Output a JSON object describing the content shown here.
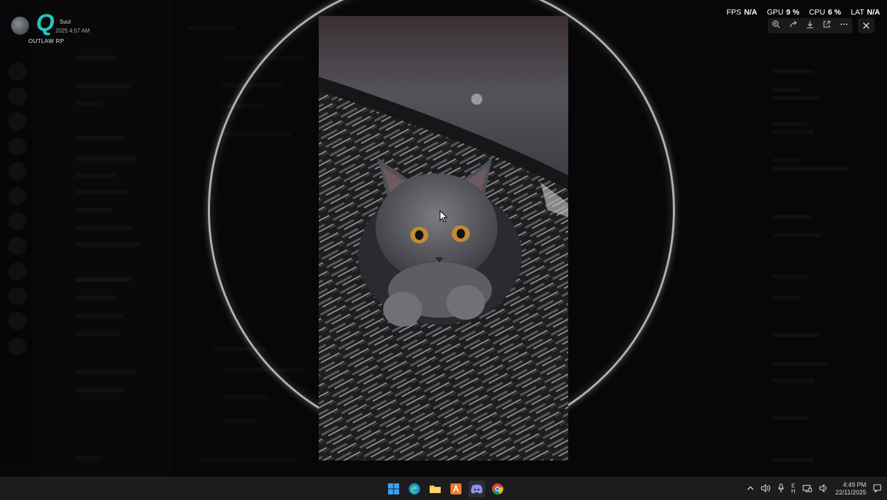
{
  "app": {
    "logo_text": "OUTLAW RP",
    "user_badge": "Suul",
    "user_time": "2025 4:57 AM"
  },
  "metrics": [
    {
      "label": "FPS",
      "value": "N/A"
    },
    {
      "label": "GPU",
      "value": "9 %"
    },
    {
      "label": "CPU",
      "value": "6 %"
    },
    {
      "label": "LAT",
      "value": "N/A"
    }
  ],
  "viewer_toolbar": {
    "icons": [
      "zoom-in-icon",
      "share-icon",
      "download-icon",
      "open-external-icon",
      "more-icon"
    ],
    "close_icon": "close-icon"
  },
  "taskbar": {
    "apps": [
      "windows-start-icon",
      "edge-icon",
      "file-explorer-icon",
      "app-icon",
      "discord-icon",
      "chrome-icon"
    ],
    "tray_icons": [
      "chevron-up-icon",
      "speaker-icon",
      "microphone-icon",
      "language-icon",
      "network-icon",
      "volume-icon",
      "notification-icon"
    ],
    "language": "E\nH",
    "time": "4:49 PM",
    "date": "22/11/2025"
  },
  "colors": {
    "accent_logo": "#26c2c8",
    "taskbar_bg": "#1c1c1e"
  }
}
